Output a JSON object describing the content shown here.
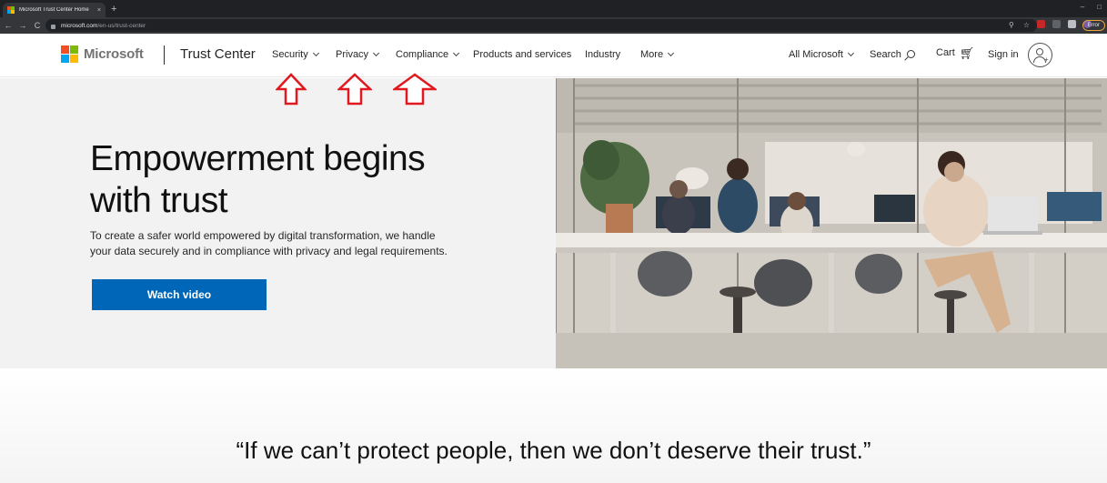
{
  "browser": {
    "tab_title": "Microsoft Trust Center Home",
    "tab_close": "×",
    "new_tab": "+",
    "window_controls": [
      "–",
      "□"
    ],
    "nav": {
      "back": "←",
      "forward": "→",
      "reload": "C"
    },
    "url_host": "microsoft.com",
    "url_path": "/en-us/trust-center",
    "omni_icons": {
      "zoom": "⚲",
      "bookmark": "☆"
    },
    "error_label": "Error"
  },
  "header": {
    "logo_text": "Microsoft",
    "brand": "Trust Center",
    "nav_items": [
      {
        "label": "Security",
        "has_dropdown": true
      },
      {
        "label": "Privacy",
        "has_dropdown": true
      },
      {
        "label": "Compliance",
        "has_dropdown": true
      },
      {
        "label": "Products and services",
        "has_dropdown": false
      },
      {
        "label": "Industry",
        "has_dropdown": false
      },
      {
        "label": "More",
        "has_dropdown": true
      }
    ],
    "all_microsoft": "All Microsoft",
    "search": "Search",
    "cart": "Cart",
    "sign_in": "Sign in"
  },
  "hero": {
    "title_line1": "Empowerment begins",
    "title_line2": "with trust",
    "text_line1": "To create a safer world empowered by digital transformation, we handle",
    "text_line2": "your data securely and in compliance with privacy and legal requirements.",
    "button": "Watch video"
  },
  "quote": {
    "text": "“If we can’t protect people, then we don’t deserve their trust.”"
  },
  "colors": {
    "ms_red": "#f25022",
    "ms_green": "#7fba00",
    "ms_blue": "#00a4ef",
    "ms_yellow": "#ffb900",
    "button_blue": "#0067b8",
    "annotation_red": "#e0181f"
  }
}
